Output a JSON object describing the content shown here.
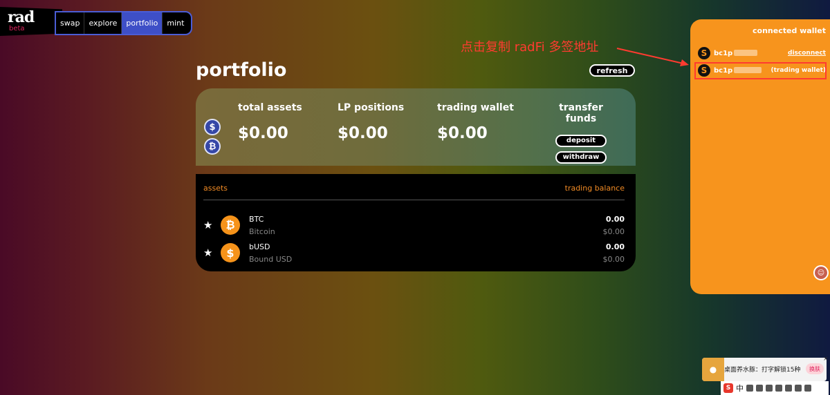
{
  "logo": {
    "text": "rad",
    "sub": "beta"
  },
  "nav": {
    "items": [
      "swap",
      "explore",
      "portfolio",
      "mint"
    ],
    "active": "portfolio"
  },
  "page": {
    "title": "portfolio",
    "refresh_label": "refresh"
  },
  "summary": {
    "total_assets_label": "total assets",
    "total_assets_value": "$0.00",
    "lp_label": "LP positions",
    "lp_value": "$0.00",
    "trading_label": "trading wallet",
    "trading_value": "$0.00",
    "transfer_label": "transfer funds",
    "deposit_label": "deposit",
    "withdraw_label": "withdraw",
    "coins": [
      "$",
      "₿"
    ]
  },
  "assets": {
    "header_left": "assets",
    "header_right": "trading balance",
    "rows": [
      {
        "symbol": "BTC",
        "name": "Bitcoin",
        "amount": "0.00",
        "usd": "$0.00",
        "icon": "₿"
      },
      {
        "symbol": "bUSD",
        "name": "Bound USD",
        "amount": "0.00",
        "usd": "$0.00",
        "icon": "$"
      }
    ]
  },
  "annotation": {
    "text": "点击复制 radFi 多签地址",
    "color": "#ff3b30"
  },
  "wallet": {
    "title": "connected wallet",
    "rows": [
      {
        "addr": "bc1p",
        "action": "disconnect"
      },
      {
        "addr": "bc1p",
        "tag": "(trading wallet)"
      }
    ]
  },
  "ime": {
    "message": "桌面养水豚：打字解锁15种萌宠",
    "button": "换肤",
    "bar_label": "中",
    "close": "×"
  },
  "colors": {
    "accent": "#f7941d",
    "nav_active": "#3e4fc7",
    "annotation": "#ff3b30",
    "beta": "#e0245e"
  }
}
